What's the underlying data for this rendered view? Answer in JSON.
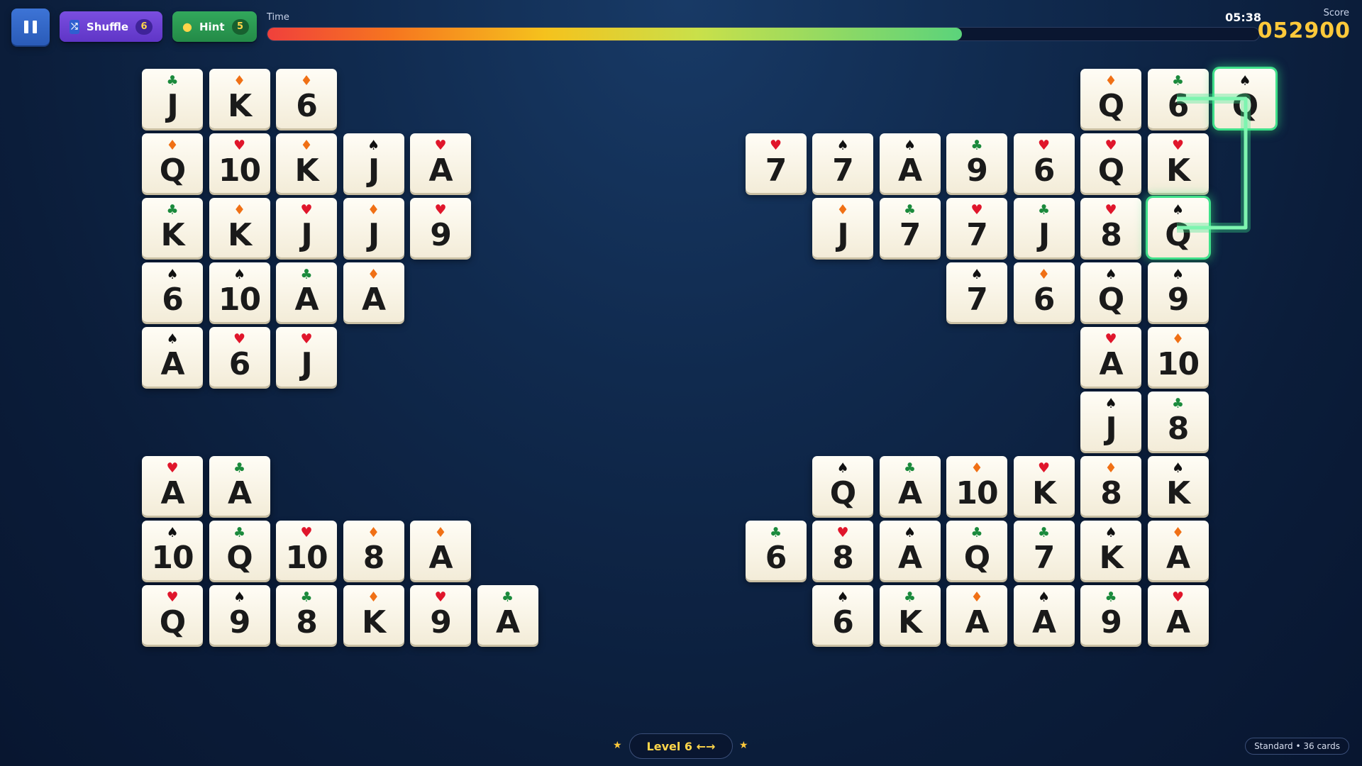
{
  "hud": {
    "shuffle_label": "Shuffle",
    "shuffle_count": "6",
    "hint_label": "Hint",
    "hint_count": "5",
    "time_label": "Time",
    "time_value": "05:38",
    "time_progress_fraction": 0.7,
    "score_label": "Score",
    "score_value": "052900"
  },
  "footer": {
    "level_label": "Level 6 ←→",
    "mode_label": "Standard • 36 cards"
  },
  "suit_symbols": {
    "h": "♥",
    "d": "♦",
    "c": "♣",
    "s": "♠"
  },
  "colors": {
    "hearts": "#e0162b",
    "diamonds": "#f07015",
    "clubs": "#1b8a3c",
    "spades": "#111111",
    "selection_glow": "#3fe08a",
    "score": "#ffc93a"
  },
  "selection": {
    "connected_pair": [
      "Q♠ (row 1, col 17)",
      "Q♠ (row 3, col 17)"
    ]
  },
  "cards": [
    {
      "row": 1,
      "col": 1,
      "rank": "J",
      "suit": "c"
    },
    {
      "row": 1,
      "col": 2,
      "rank": "K",
      "suit": "d"
    },
    {
      "row": 1,
      "col": 3,
      "rank": "6",
      "suit": "d"
    },
    {
      "row": 1,
      "col": 15,
      "rank": "Q",
      "suit": "d"
    },
    {
      "row": 1,
      "col": 16,
      "rank": "6",
      "suit": "c"
    },
    {
      "row": 1,
      "col": 17,
      "rank": "Q",
      "suit": "s",
      "selected": true
    },
    {
      "row": 2,
      "col": 1,
      "rank": "Q",
      "suit": "d"
    },
    {
      "row": 2,
      "col": 2,
      "rank": "10",
      "suit": "h"
    },
    {
      "row": 2,
      "col": 3,
      "rank": "K",
      "suit": "d"
    },
    {
      "row": 2,
      "col": 4,
      "rank": "J",
      "suit": "s"
    },
    {
      "row": 2,
      "col": 5,
      "rank": "A",
      "suit": "h"
    },
    {
      "row": 2,
      "col": 10,
      "rank": "7",
      "suit": "h"
    },
    {
      "row": 2,
      "col": 11,
      "rank": "7",
      "suit": "s"
    },
    {
      "row": 2,
      "col": 12,
      "rank": "A",
      "suit": "s"
    },
    {
      "row": 2,
      "col": 13,
      "rank": "9",
      "suit": "c"
    },
    {
      "row": 2,
      "col": 14,
      "rank": "6",
      "suit": "h"
    },
    {
      "row": 2,
      "col": 15,
      "rank": "Q",
      "suit": "h"
    },
    {
      "row": 2,
      "col": 16,
      "rank": "K",
      "suit": "h"
    },
    {
      "row": 3,
      "col": 1,
      "rank": "K",
      "suit": "c"
    },
    {
      "row": 3,
      "col": 2,
      "rank": "K",
      "suit": "d"
    },
    {
      "row": 3,
      "col": 3,
      "rank": "J",
      "suit": "h"
    },
    {
      "row": 3,
      "col": 4,
      "rank": "J",
      "suit": "d"
    },
    {
      "row": 3,
      "col": 5,
      "rank": "9",
      "suit": "h"
    },
    {
      "row": 3,
      "col": 11,
      "rank": "J",
      "suit": "d"
    },
    {
      "row": 3,
      "col": 12,
      "rank": "7",
      "suit": "c"
    },
    {
      "row": 3,
      "col": 13,
      "rank": "7",
      "suit": "h"
    },
    {
      "row": 3,
      "col": 14,
      "rank": "J",
      "suit": "c"
    },
    {
      "row": 3,
      "col": 15,
      "rank": "8",
      "suit": "h"
    },
    {
      "row": 3,
      "col": 16,
      "rank": "Q",
      "suit": "s",
      "selected": true
    },
    {
      "row": 4,
      "col": 1,
      "rank": "6",
      "suit": "s"
    },
    {
      "row": 4,
      "col": 2,
      "rank": "10",
      "suit": "s"
    },
    {
      "row": 4,
      "col": 3,
      "rank": "A",
      "suit": "c"
    },
    {
      "row": 4,
      "col": 4,
      "rank": "A",
      "suit": "d"
    },
    {
      "row": 4,
      "col": 13,
      "rank": "7",
      "suit": "s"
    },
    {
      "row": 4,
      "col": 14,
      "rank": "6",
      "suit": "d"
    },
    {
      "row": 4,
      "col": 15,
      "rank": "Q",
      "suit": "s"
    },
    {
      "row": 4,
      "col": 16,
      "rank": "9",
      "suit": "s"
    },
    {
      "row": 5,
      "col": 1,
      "rank": "A",
      "suit": "s"
    },
    {
      "row": 5,
      "col": 2,
      "rank": "6",
      "suit": "h"
    },
    {
      "row": 5,
      "col": 3,
      "rank": "J",
      "suit": "h"
    },
    {
      "row": 5,
      "col": 15,
      "rank": "A",
      "suit": "h"
    },
    {
      "row": 5,
      "col": 16,
      "rank": "10",
      "suit": "d"
    },
    {
      "row": 6,
      "col": 15,
      "rank": "J",
      "suit": "s"
    },
    {
      "row": 6,
      "col": 16,
      "rank": "8",
      "suit": "c"
    },
    {
      "row": 7,
      "col": 1,
      "rank": "A",
      "suit": "h"
    },
    {
      "row": 7,
      "col": 2,
      "rank": "A",
      "suit": "c"
    },
    {
      "row": 7,
      "col": 11,
      "rank": "Q",
      "suit": "s"
    },
    {
      "row": 7,
      "col": 12,
      "rank": "A",
      "suit": "c"
    },
    {
      "row": 7,
      "col": 13,
      "rank": "10",
      "suit": "d"
    },
    {
      "row": 7,
      "col": 14,
      "rank": "K",
      "suit": "h"
    },
    {
      "row": 7,
      "col": 15,
      "rank": "8",
      "suit": "d"
    },
    {
      "row": 7,
      "col": 16,
      "rank": "K",
      "suit": "s"
    },
    {
      "row": 8,
      "col": 1,
      "rank": "10",
      "suit": "s"
    },
    {
      "row": 8,
      "col": 2,
      "rank": "Q",
      "suit": "c"
    },
    {
      "row": 8,
      "col": 3,
      "rank": "10",
      "suit": "h"
    },
    {
      "row": 8,
      "col": 4,
      "rank": "8",
      "suit": "d"
    },
    {
      "row": 8,
      "col": 5,
      "rank": "A",
      "suit": "d"
    },
    {
      "row": 8,
      "col": 10,
      "rank": "6",
      "suit": "c"
    },
    {
      "row": 8,
      "col": 11,
      "rank": "8",
      "suit": "h"
    },
    {
      "row": 8,
      "col": 12,
      "rank": "A",
      "suit": "s"
    },
    {
      "row": 8,
      "col": 13,
      "rank": "Q",
      "suit": "c"
    },
    {
      "row": 8,
      "col": 14,
      "rank": "7",
      "suit": "c"
    },
    {
      "row": 8,
      "col": 15,
      "rank": "K",
      "suit": "s"
    },
    {
      "row": 8,
      "col": 16,
      "rank": "A",
      "suit": "d"
    },
    {
      "row": 9,
      "col": 1,
      "rank": "Q",
      "suit": "h"
    },
    {
      "row": 9,
      "col": 2,
      "rank": "9",
      "suit": "s"
    },
    {
      "row": 9,
      "col": 3,
      "rank": "8",
      "suit": "c"
    },
    {
      "row": 9,
      "col": 4,
      "rank": "K",
      "suit": "d"
    },
    {
      "row": 9,
      "col": 5,
      "rank": "9",
      "suit": "h"
    },
    {
      "row": 9,
      "col": 6,
      "rank": "A",
      "suit": "c"
    },
    {
      "row": 9,
      "col": 11,
      "rank": "6",
      "suit": "s"
    },
    {
      "row": 9,
      "col": 12,
      "rank": "K",
      "suit": "c"
    },
    {
      "row": 9,
      "col": 13,
      "rank": "A",
      "suit": "d"
    },
    {
      "row": 9,
      "col": 14,
      "rank": "A",
      "suit": "s"
    },
    {
      "row": 9,
      "col": 15,
      "rank": "9",
      "suit": "c"
    },
    {
      "row": 9,
      "col": 16,
      "rank": "A",
      "suit": "h"
    }
  ]
}
